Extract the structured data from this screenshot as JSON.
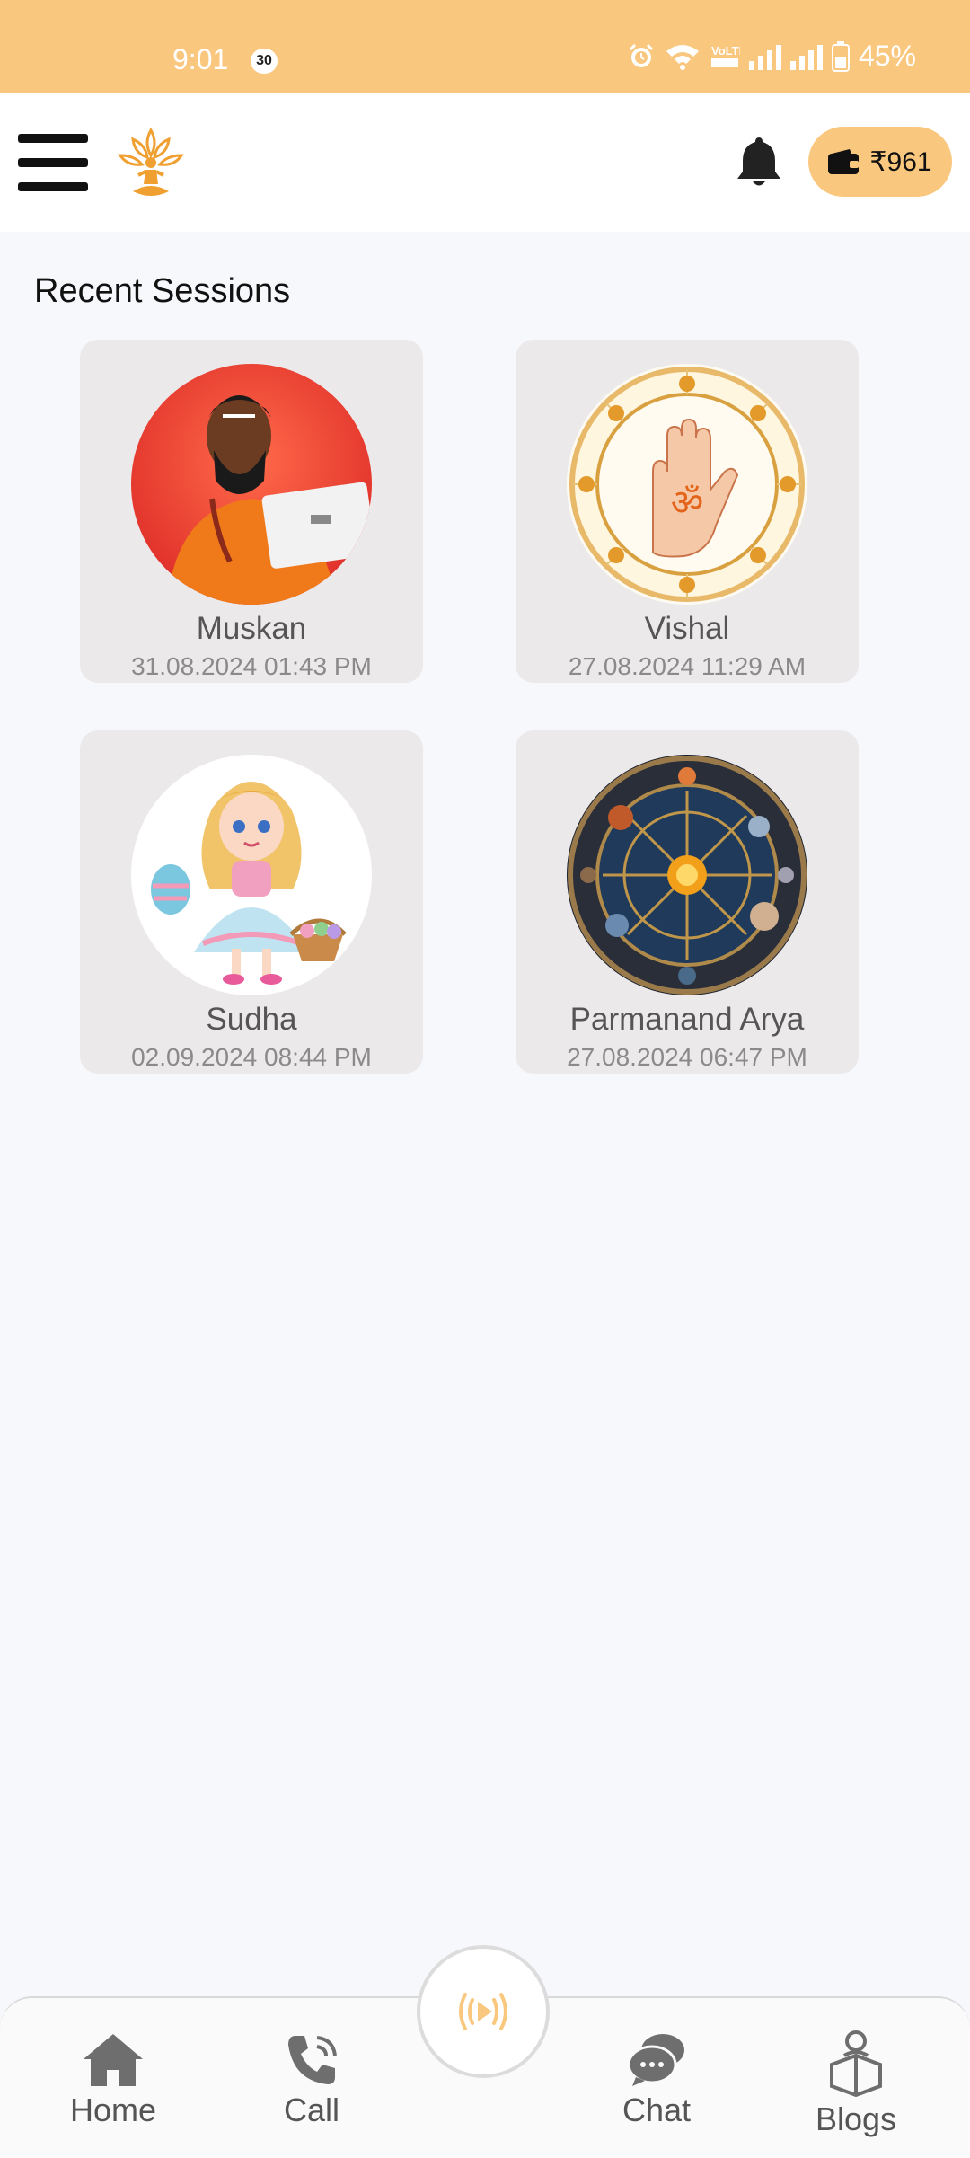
{
  "status_bar": {
    "time": "9:01",
    "notification_count": "30",
    "network_label": "VoLTE",
    "battery": "45%"
  },
  "header": {
    "wallet_amount": "₹961",
    "accent_color": "#f9c77e"
  },
  "main": {
    "section_title": "Recent Sessions",
    "sessions": [
      {
        "name": "Muskan",
        "date": "31.08.2024 01:43 PM"
      },
      {
        "name": "Vishal",
        "date": "27.08.2024 11:29 AM"
      },
      {
        "name": "Sudha",
        "date": "02.09.2024 08:44 PM"
      },
      {
        "name": "Parmanand Arya",
        "date": "27.08.2024 06:47 PM"
      }
    ]
  },
  "bottom_nav": {
    "items": [
      {
        "label": "Home",
        "icon": "home-icon"
      },
      {
        "label": "Call",
        "icon": "phone-icon"
      },
      {
        "label": "Chat",
        "icon": "chat-icon"
      },
      {
        "label": "Blogs",
        "icon": "blogs-icon"
      }
    ],
    "center_icon": "live-stream-icon"
  }
}
